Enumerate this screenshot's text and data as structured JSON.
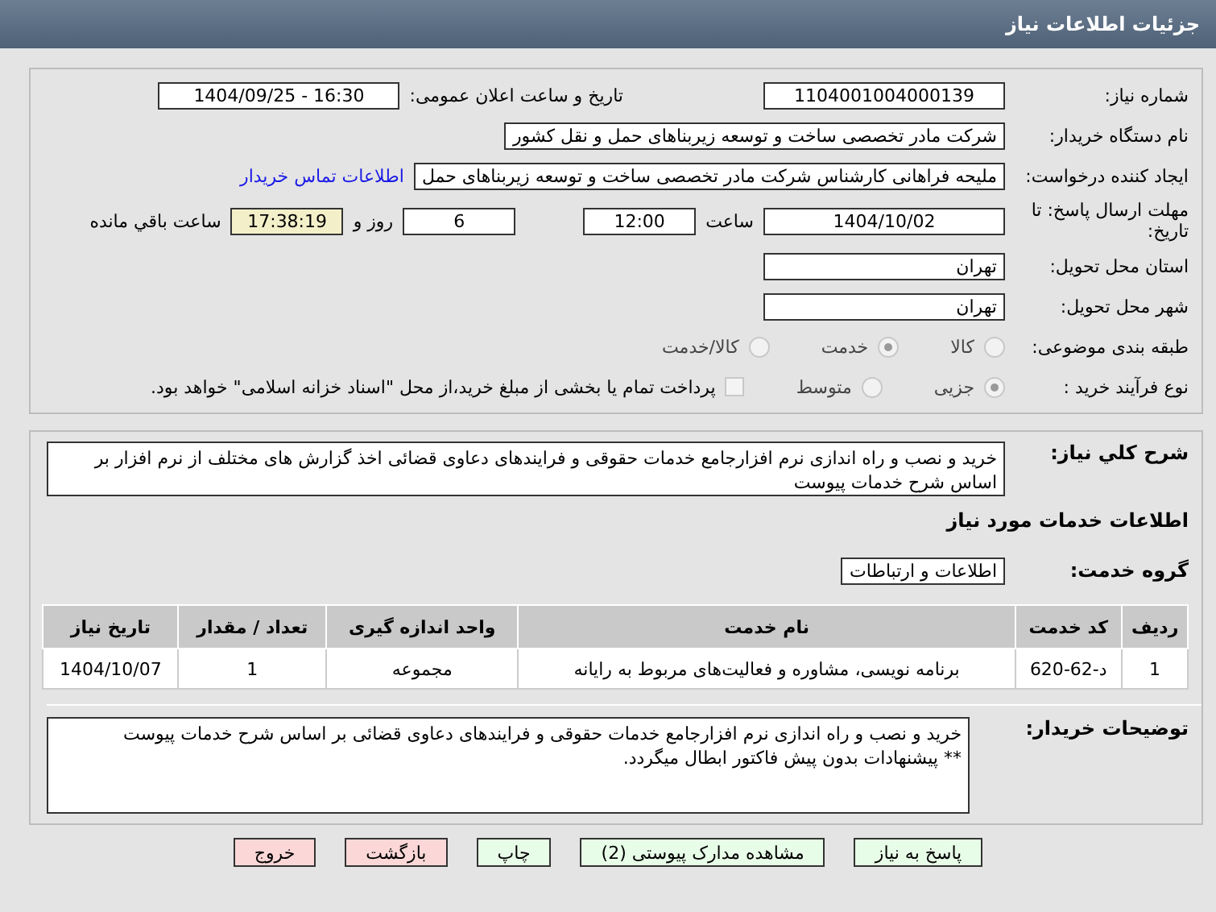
{
  "header": {
    "title": "جزئیات اطلاعات نیاز"
  },
  "need": {
    "number_label": "شماره نیاز:",
    "number": "1104001004000139",
    "announce_label": "تاریخ و ساعت اعلان عمومی:",
    "announce": "1404/09/25 - 16:30",
    "buyer_label": "نام دستگاه خریدار:",
    "buyer": "شرکت مادر تخصصی ساخت و توسعه زیربناهای حمل و نقل کشور",
    "creator_label": "ایجاد کننده درخواست:",
    "creator": "ملیحه فراهانی کارشناس شرکت مادر تخصصی ساخت و توسعه زیربناهای حمل",
    "contact_link": "اطلاعات تماس خریدار",
    "deadline_label": "مهلت ارسال پاسخ: تا تاریخ:",
    "deadline_date": "1404/10/02",
    "time_label": "ساعت",
    "deadline_time": "12:00",
    "days": "6",
    "days_label": "روز و",
    "remaining": "17:38:19",
    "remaining_label": "ساعت باقي مانده",
    "province_label": "استان محل تحویل:",
    "province": "تهران",
    "city_label": "شهر محل تحویل:",
    "city": "تهران",
    "category_label": "طبقه بندی موضوعی:",
    "category_options": [
      {
        "label": "کالا",
        "selected": false
      },
      {
        "label": "خدمت",
        "selected": true
      },
      {
        "label": "کالا/خدمت",
        "selected": false
      }
    ],
    "process_label": "نوع فرآیند خرید :",
    "process_options": [
      {
        "label": "جزیی",
        "selected": true
      },
      {
        "label": "متوسط",
        "selected": false
      }
    ],
    "payment": {
      "checked": false,
      "label": "پرداخت تمام یا بخشی از مبلغ خرید،از محل \"اسناد خزانه اسلامی\" خواهد بود."
    }
  },
  "details": {
    "summary_label": "شرح کلي نياز:",
    "summary": "خرید و نصب و راه اندازی نرم افزارجامع خدمات حقوقی و فرایندهای دعاوی قضائی اخذ گزارش های مختلف از نرم افزار  بر اساس شرح خدمات پیوست",
    "services_title": "اطلاعات خدمات مورد نیاز",
    "group_label": "گروه خدمت:",
    "group": "اطلاعات و ارتباطات",
    "table": {
      "columns": [
        "ردیف",
        "کد خدمت",
        "نام خدمت",
        "واحد اندازه گیری",
        "تعداد / مقدار",
        "تاریخ نیاز"
      ],
      "rows": [
        [
          "1",
          "د-62-620",
          "برنامه نویسی، مشاوره و فعالیت‌های مربوط به رایانه",
          "مجموعه",
          "1",
          "1404/10/07"
        ]
      ]
    },
    "notes_label": "توضیحات خریدار:",
    "notes": [
      "خرید و نصب و راه اندازی نرم افزارجامع خدمات حقوقی و فرایندهای دعاوی قضائی بر اساس شرح خدمات پیوست",
      "** پیشنهادات بدون پیش فاکتور ابطال میگردد."
    ]
  },
  "buttons": [
    {
      "label": "پاسخ به نیاز",
      "kind": "normal"
    },
    {
      "label": "مشاهده مدارک پیوستی (2)",
      "kind": "normal"
    },
    {
      "label": "چاپ",
      "kind": "normal"
    },
    {
      "label": "بازگشت",
      "kind": "danger"
    },
    {
      "label": "خروج",
      "kind": "danger"
    }
  ]
}
